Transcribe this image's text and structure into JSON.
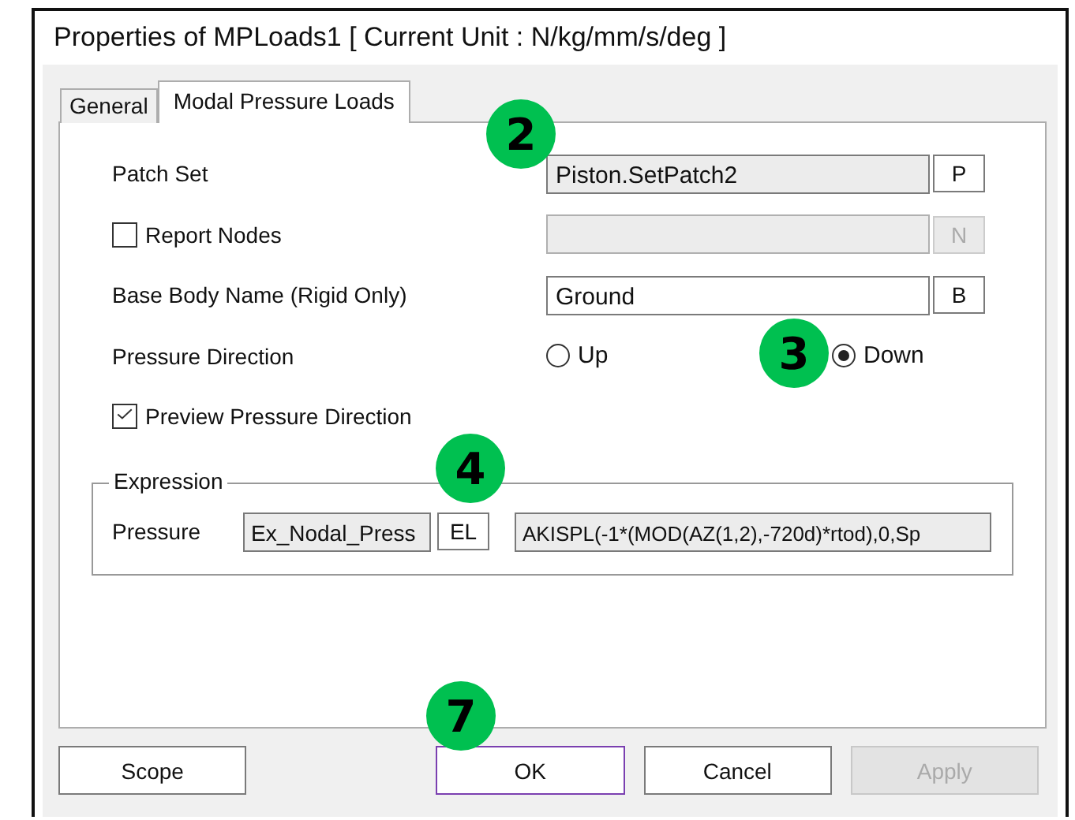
{
  "window": {
    "title": "Properties of MPLoads1 [ Current Unit : N/kg/mm/s/deg ]"
  },
  "tabs": [
    {
      "label": "General",
      "selected": false
    },
    {
      "label": "Modal Pressure Loads",
      "selected": true
    }
  ],
  "rows": [
    {
      "kind": "field",
      "label": "Patch Set",
      "value": "Piston.SetPatch2",
      "readonly": true,
      "button": "P",
      "disabled": false
    },
    {
      "kind": "check-field",
      "label": "Report Nodes",
      "checked": false,
      "button": "N",
      "disabled": true
    },
    {
      "kind": "field",
      "label": "Base Body Name (Rigid Only)",
      "value": "Ground",
      "readonly": false,
      "button": "B",
      "disabled": false
    },
    {
      "kind": "radio",
      "label": "Pressure Direction",
      "options": [
        {
          "label": "Up",
          "selected": false
        },
        {
          "label": "Down",
          "selected": true
        }
      ]
    },
    {
      "kind": "checkbox",
      "label": "Preview Pressure Direction",
      "checked": true
    }
  ],
  "expression": {
    "title": "Expression",
    "label": "Pressure",
    "name": "Ex_Nodal_Press",
    "button": "EL",
    "value": "AKISPL(-1*(MOD(AZ(1,2),-720d)*rtod),0,Sp"
  },
  "buttons": [
    {
      "label": "Scope",
      "disabled": false,
      "focused": false
    },
    {
      "label": "OK",
      "disabled": false,
      "focused": true
    },
    {
      "label": "Cancel",
      "disabled": false,
      "focused": false
    },
    {
      "label": "Apply",
      "disabled": true,
      "focused": false
    }
  ],
  "badges": [
    {
      "number": "2"
    },
    {
      "number": "3"
    },
    {
      "number": "4"
    },
    {
      "number": "7"
    }
  ]
}
